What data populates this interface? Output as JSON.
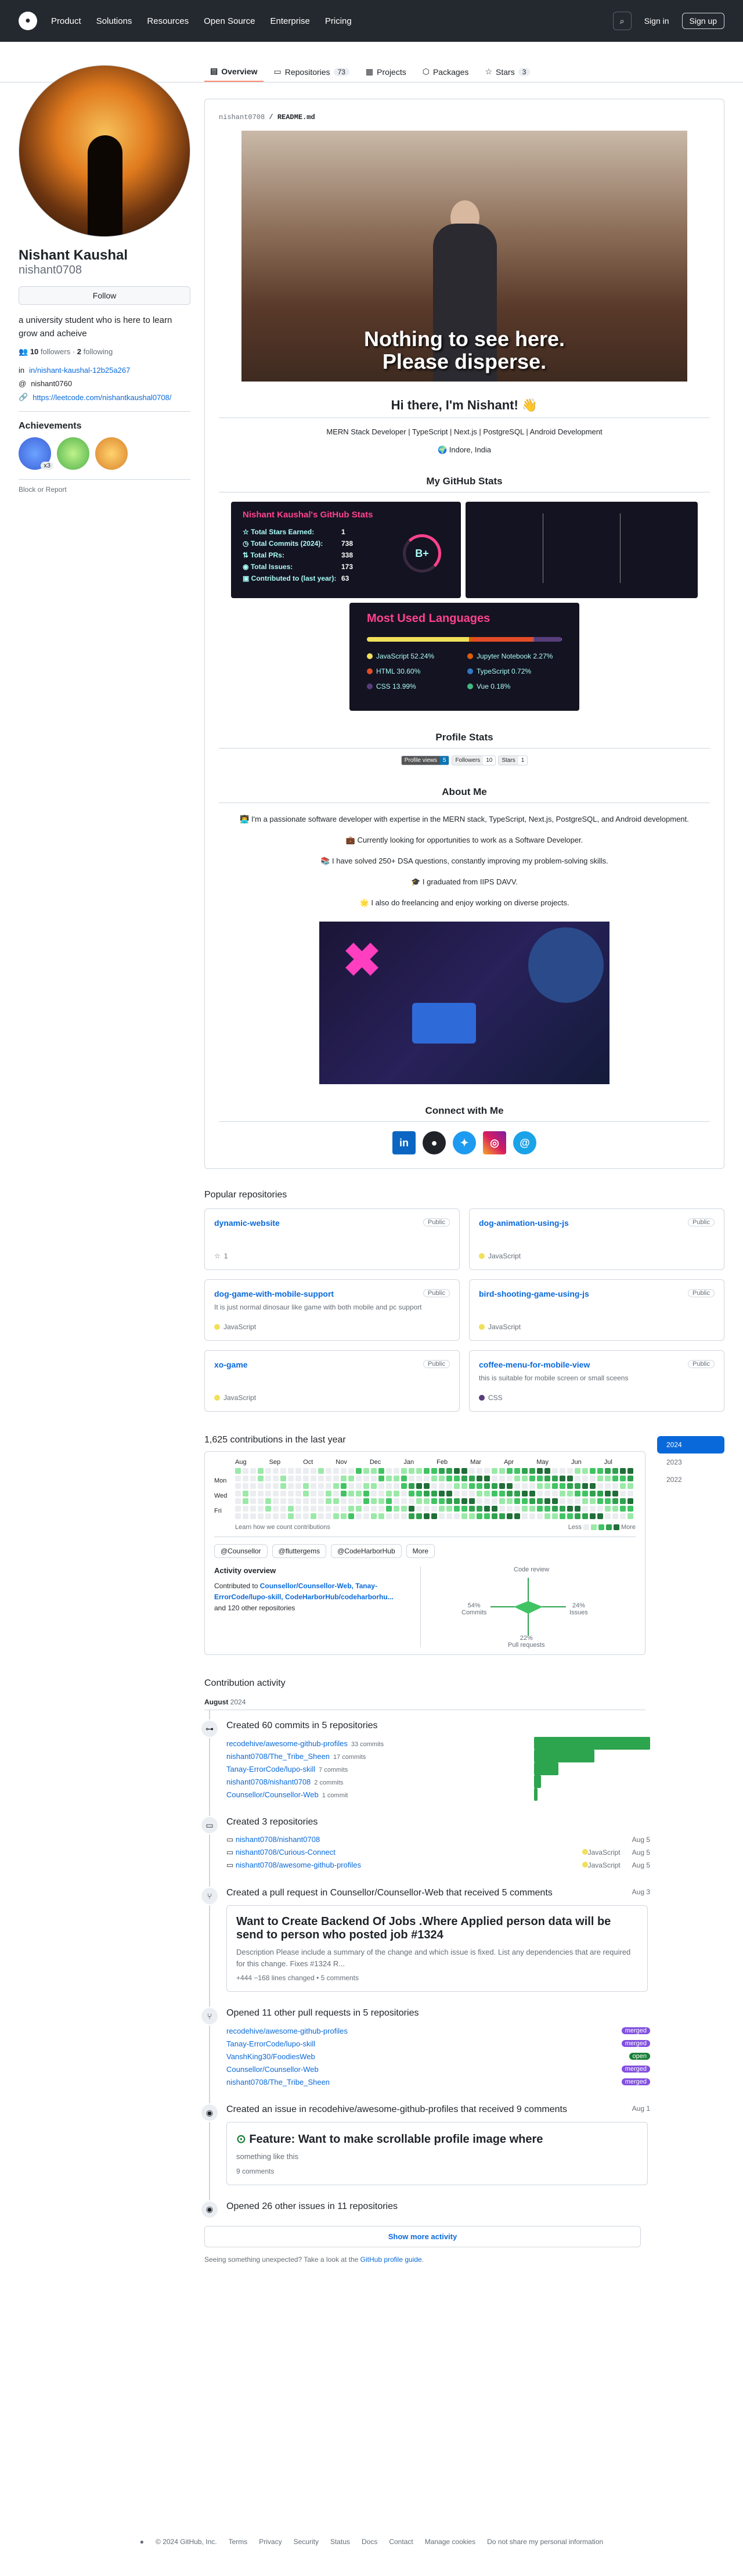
{
  "nav": {
    "items": [
      "Product",
      "Solutions",
      "Resources",
      "Open Source",
      "Enterprise",
      "Pricing"
    ],
    "signin": "Sign in",
    "signup": "Sign up"
  },
  "tabs": [
    {
      "label": "Overview"
    },
    {
      "label": "Repositories",
      "count": "73"
    },
    {
      "label": "Projects"
    },
    {
      "label": "Packages"
    },
    {
      "label": "Stars",
      "count": "3"
    }
  ],
  "profile": {
    "name": "Nishant Kaushal",
    "login": "nishant0708",
    "follow": "Follow",
    "bio": "a university student who is here to learn grow and acheive",
    "followers": "10",
    "followers_label": "followers",
    "following": "2",
    "following_label": "following",
    "linkedin": "in/nishant-kaushal-12b25a267",
    "handle": "nishant0760",
    "link": "https://leetcode.com/nishantkaushal0708/",
    "achievements": "Achievements",
    "badge_count": "x3",
    "block": "Block or Report"
  },
  "readme": {
    "path": "nishant0708",
    "file": "README.md",
    "gif_caption_1": "Nothing to see here.",
    "gif_caption_2": "Please disperse.",
    "hi": "Hi there, I'm Nishant! 👋",
    "tagline": "MERN Stack Developer | TypeScript | Next.js | PostgreSQL | Android Development",
    "location": "🌍 Indore, India",
    "stats_heading": "My GitHub Stats",
    "profile_stats": "Profile Stats",
    "about": "About Me",
    "connect": "Connect with Me",
    "about_lines": [
      "👨‍💻 I'm a passionate software developer with expertise in the MERN stack, TypeScript, Next.js, PostgreSQL, and Android development.",
      "💼 Currently looking for opportunities to work as a Software Developer.",
      "📚 I have solved 250+ DSA questions, constantly improving my problem-solving skills.",
      "🎓 I graduated from IIPS DAVV.",
      "🌟 I also do freelancing and enjoy working on diverse projects."
    ]
  },
  "stats_card": {
    "title": "Nishant Kaushal's GitHub Stats",
    "rows": [
      {
        "k": "Total Stars Earned:",
        "v": "1"
      },
      {
        "k": "Total Commits (2024):",
        "v": "738"
      },
      {
        "k": "Total PRs:",
        "v": "338"
      },
      {
        "k": "Total Issues:",
        "v": "173"
      },
      {
        "k": "Contributed to (last year):",
        "v": "63"
      }
    ],
    "grade": "B+"
  },
  "langs": {
    "title": "Most Used Languages",
    "items": [
      {
        "name": "JavaScript 52.24%",
        "pct": 52.24,
        "color": "#f1e05a"
      },
      {
        "name": "Jupyter Notebook 2.27%",
        "pct": 2.27,
        "color": "#da5b0b"
      },
      {
        "name": "HTML 30.60%",
        "pct": 30.6,
        "color": "#e34c26"
      },
      {
        "name": "TypeScript 0.72%",
        "pct": 0.72,
        "color": "#3178c6"
      },
      {
        "name": "CSS 13.99%",
        "pct": 13.99,
        "color": "#563d7c"
      },
      {
        "name": "Vue 0.18%",
        "pct": 0.18,
        "color": "#41b883"
      }
    ]
  },
  "shields": {
    "views_k": "Profile views",
    "views_v": "5",
    "followers_k": "Followers",
    "followers_v": "10",
    "stars_k": "Stars",
    "stars_v": "1"
  },
  "popular": {
    "heading": "Popular repositories",
    "public": "Public",
    "repos": [
      {
        "name": "dynamic-website",
        "desc": "",
        "lang": "",
        "stars": "1"
      },
      {
        "name": "dog-animation-using-js",
        "desc": "",
        "lang": "JavaScript",
        "color": "#f1e05a"
      },
      {
        "name": "dog-game-with-mobile-support",
        "desc": "It is just normal dinosaur like game with both mobile and pc support",
        "lang": "JavaScript",
        "color": "#f1e05a"
      },
      {
        "name": "bird-shooting-game-using-js",
        "desc": "",
        "lang": "JavaScript",
        "color": "#f1e05a"
      },
      {
        "name": "xo-game",
        "desc": "",
        "lang": "JavaScript",
        "color": "#f1e05a"
      },
      {
        "name": "coffee-menu-for-mobile-view",
        "desc": "this is suitable for mobile screen or small sceens",
        "lang": "CSS",
        "color": "#563d7c"
      }
    ]
  },
  "contrib": {
    "heading": "1,625 contributions in the last year",
    "years": [
      "2024",
      "2023",
      "2022"
    ],
    "months": [
      "Aug",
      "Sep",
      "Oct",
      "Nov",
      "Dec",
      "Jan",
      "Feb",
      "Mar",
      "Apr",
      "May",
      "Jun",
      "Jul"
    ],
    "days": [
      "Mon",
      "Wed",
      "Fri"
    ],
    "learn": "Learn how we count contributions",
    "less": "Less",
    "more": "More",
    "orgs": [
      "@Counsellor",
      "@fluttergems",
      "@CodeHarborHub",
      "More"
    ],
    "overview": "Activity overview",
    "contributed": "Contributed to",
    "repos_line": "Counsellor/Counsellor-Web, Tanay-ErrorCode/lupo-skill, CodeHarborHub/codeharborhu...",
    "others": "and 120 other repositories",
    "code_review": "Code review",
    "commits": "54%\nCommits",
    "issues": "24%\nIssues",
    "prs": "22%\nPull requests"
  },
  "activity": {
    "heading": "Contribution activity",
    "month": "August",
    "year": "2024",
    "commits_title": "Created 60 commits in 5 repositories",
    "commit_rows": [
      {
        "repo": "recodehive/awesome-github-profiles",
        "n": "33 commits",
        "w": 1.0
      },
      {
        "repo": "nishant0708/The_Tribe_Sheen",
        "n": "17 commits",
        "w": 0.52
      },
      {
        "repo": "Tanay-ErrorCode/lupo-skill",
        "n": "7 commits",
        "w": 0.21
      },
      {
        "repo": "nishant0708/nishant0708",
        "n": "2 commits",
        "w": 0.06
      },
      {
        "repo": "Counsellor/Counsellor-Web",
        "n": "1 commit",
        "w": 0.03
      }
    ],
    "repos_title": "Created 3 repositories",
    "repo_rows": [
      {
        "repo": "nishant0708/nishant0708",
        "lang": "",
        "date": "Aug 5"
      },
      {
        "repo": "nishant0708/Curious-Connect",
        "lang": "JavaScript",
        "date": "Aug 5"
      },
      {
        "repo": "nishant0708/awesome-github-profiles",
        "lang": "JavaScript",
        "date": "Aug 5"
      }
    ],
    "pr_title": "Created a pull request in Counsellor/Counsellor-Web that received 5 comments",
    "pr_date": "Aug 3",
    "pr_card": {
      "title": "Want to Create Backend Of Jobs .Where Applied person data will be send to person who posted job #1324",
      "desc": "Description Please include a summary of the change and which issue is fixed. List any dependencies that are required for this change. Fixes #1324 R...",
      "stat": "+444 −168 lines changed • 5 comments"
    },
    "opr_title": "Opened 11 other pull requests in 5 repositories",
    "opr_rows": [
      {
        "repo": "recodehive/awesome-github-profiles",
        "tag": "merged"
      },
      {
        "repo": "Tanay-ErrorCode/lupo-skill",
        "tag": "merged"
      },
      {
        "repo": "VanshKing30/FoodiesWeb",
        "tag": "open"
      },
      {
        "repo": "Counsellor/Counsellor-Web",
        "tag": "merged"
      },
      {
        "repo": "nishant0708/The_Tribe_Sheen",
        "tag": "merged"
      }
    ],
    "issue_title": "Created an issue in recodehive/awesome-github-profiles that received 9 comments",
    "issue_date": "Aug 1",
    "issue_card": {
      "title": "Feature: Want to make scrollable profile image where",
      "desc": "something like this",
      "comments": "9 comments"
    },
    "other_issues": "Opened 26 other issues in 11 repositories",
    "show_more": "Show more activity",
    "unexpected": "Seeing something unexpected? Take a look at the",
    "guide": "GitHub profile guide"
  },
  "footer": {
    "copy": "© 2024 GitHub, Inc.",
    "links": [
      "Terms",
      "Privacy",
      "Security",
      "Status",
      "Docs",
      "Contact",
      "Manage cookies",
      "Do not share my personal information"
    ]
  }
}
